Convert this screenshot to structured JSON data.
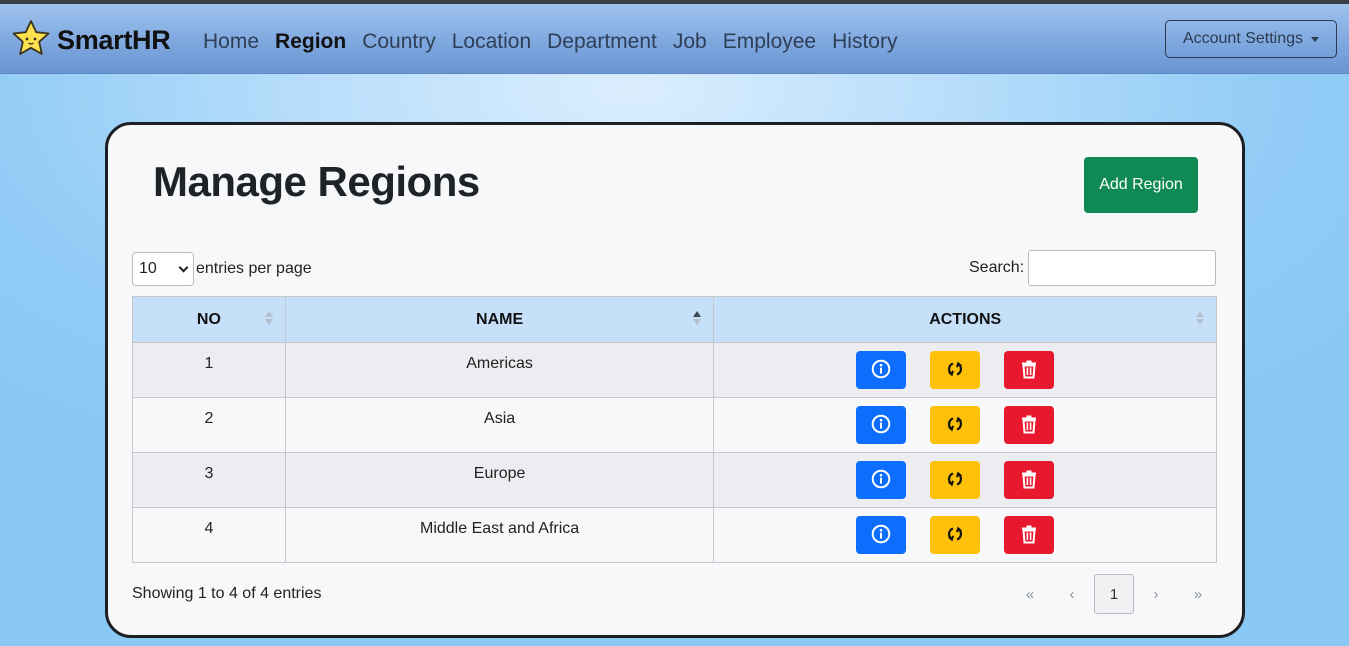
{
  "app": {
    "name": "SmartHR"
  },
  "nav": {
    "items": [
      {
        "label": "Home",
        "active": false
      },
      {
        "label": "Region",
        "active": true
      },
      {
        "label": "Country",
        "active": false
      },
      {
        "label": "Location",
        "active": false
      },
      {
        "label": "Department",
        "active": false
      },
      {
        "label": "Job",
        "active": false
      },
      {
        "label": "Employee",
        "active": false
      },
      {
        "label": "History",
        "active": false
      }
    ],
    "account_label": "Account Settings"
  },
  "page": {
    "title": "Manage Regions",
    "add_button": "Add Region"
  },
  "table_controls": {
    "entries_value": "10",
    "entries_label": "entries per page",
    "search_label": "Search:",
    "search_value": ""
  },
  "table": {
    "columns": [
      "NO",
      "NAME",
      "ACTIONS"
    ],
    "rows": [
      {
        "no": "1",
        "name": "Americas"
      },
      {
        "no": "2",
        "name": "Asia"
      },
      {
        "no": "3",
        "name": "Europe"
      },
      {
        "no": "4",
        "name": "Middle East and Africa"
      }
    ]
  },
  "footer": {
    "info": "Showing 1 to 4 of 4 entries",
    "pagination": {
      "first": "«",
      "prev": "‹",
      "current": "1",
      "next": "›",
      "last": "»"
    }
  },
  "colors": {
    "add_button": "#0f8a55",
    "detail_button": "#0d6efd",
    "update_button": "#ffc107",
    "delete_button": "#e8192f",
    "table_header": "#c7e0fa"
  },
  "icons": {
    "brand": "star-icon",
    "detail": "info-circle-icon",
    "update": "refresh-icon",
    "delete": "trash-icon"
  }
}
